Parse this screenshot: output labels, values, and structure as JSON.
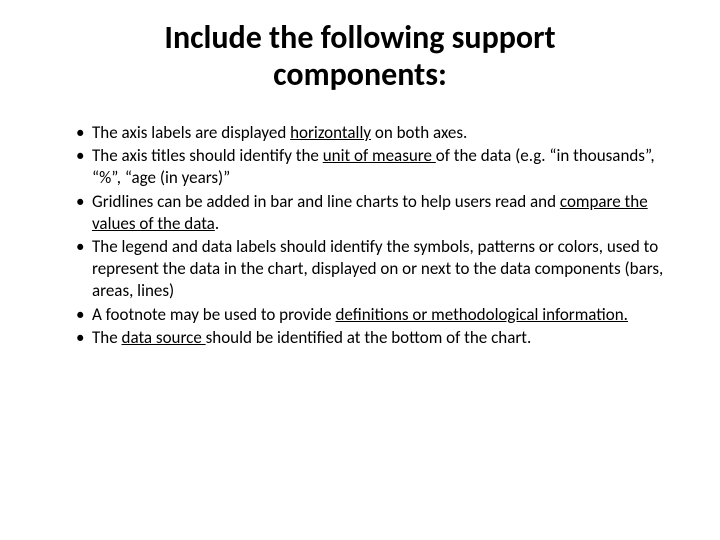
{
  "title": "Include the following support components:",
  "bullets": [
    {
      "pre": "The axis labels are displayed ",
      "u": "horizontally",
      "post": " on both axes."
    },
    {
      "pre": "The axis titles should identify the ",
      "u": "unit of measure ",
      "post": "of the data (e.g. “in thousands”, “%”, “age (in years)”"
    },
    {
      "pre": "Gridlines can be added in bar and line charts to help users read and ",
      "u": "compare the values of the data",
      "post": "."
    },
    {
      "pre": "The legend and data labels should identify the symbols, patterns or colors, used to represent the data in the chart, displayed on or next to the data components (bars, areas, lines)",
      "u": "",
      "post": ""
    },
    {
      "pre": "A footnote may be used to provide ",
      "u": "definitions or methodological information.",
      "post": ""
    },
    {
      "pre": "The ",
      "u": "data source ",
      "post": "should be identified at the bottom of the chart."
    }
  ]
}
